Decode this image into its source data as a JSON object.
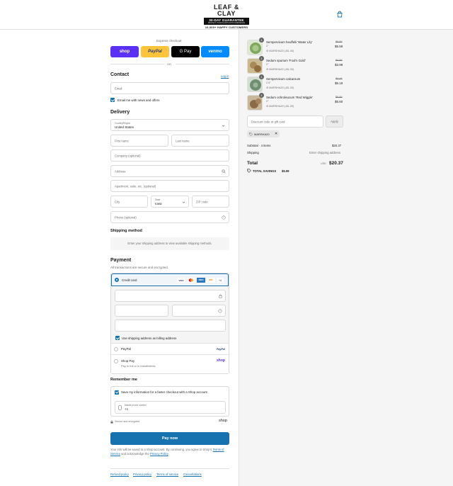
{
  "header": {
    "brand": "LEAF & CLAY",
    "guarantee": "30-DAY GUARANTEE",
    "guarantee_sub": "PROTECT YOUR PLANTS WITH CONFIDENCE",
    "customers": "10,000+ HAPPY CUSTOMERS",
    "cart_icon": "shopping-bag-icon"
  },
  "express": {
    "title": "Express checkout",
    "shop": "shop",
    "paypal": "PayPal",
    "gpay": "G Pay",
    "venmo": "venmo",
    "or": "OR"
  },
  "contact": {
    "heading": "Contact",
    "login": "Log in",
    "email_placeholder": "Email",
    "news_label": "Email me with news and offers"
  },
  "delivery": {
    "heading": "Delivery",
    "country_label": "Country/Region",
    "country_value": "United States",
    "first_name": "First name",
    "last_name": "Last name",
    "company": "Company (optional)",
    "address": "Address",
    "apartment": "Apartment, suite, etc. (optional)",
    "city": "City",
    "state_label": "State",
    "state_value": "Iowa",
    "zip": "ZIP code",
    "phone": "Phone (optional)"
  },
  "shipping": {
    "heading": "Shipping method",
    "notice": "Enter your shipping address to view available shipping methods."
  },
  "payment": {
    "heading": "Payment",
    "subtitle": "All transactions are secure and encrypted.",
    "credit_card": "Credit card",
    "card_brands": [
      "VISA",
      "MC",
      "AMEX",
      "DISC"
    ],
    "more_cards": "+4",
    "billing_label": "Use shipping address as billing address",
    "paypal": "PayPal",
    "paypal_logo": "PayPal",
    "shop_pay": "Shop Pay",
    "shop_pay_sub": "Pay in full or in installments",
    "shop_logo": "shop"
  },
  "remember": {
    "heading": "Remember me",
    "save_label": "Save my information for a faster checkout with a Shop account",
    "mobile_label": "Mobile phone number",
    "mobile_value": "+1",
    "secure": "Secure and encrypted",
    "shop_logo": "shop"
  },
  "pay_now": "Pay now",
  "legal": {
    "text1": "Your info will be saved to a Shop account. By continuing, you agree to Shop’s",
    "terms": "Terms of Service",
    "text2": "and acknowledge the",
    "privacy": "Privacy Policy",
    "text3": "."
  },
  "footer_links": [
    "Refund policy",
    "Privacy policy",
    "Terms of service",
    "Cancellations"
  ],
  "summary": {
    "items": [
      {
        "qty": "1",
        "name": "Sempervivum heuffelii 'Water Lily'",
        "size": "2\"",
        "discount": "MARSHA20 (-$1.40)",
        "old": "$6.99",
        "price": "$5.59",
        "color": "#7fa85a"
      },
      {
        "qty": "1",
        "name": "Sedum spurium 'Fool's Gold'",
        "size": "2\"",
        "discount": "MARSHA20 (-$1.00)",
        "old": "$4.99",
        "price": "$3.99",
        "color": "#a98a55"
      },
      {
        "qty": "1",
        "name": "Sempervivum calcareum",
        "size": "2.5\"",
        "discount": "MARSHA20 (-$1.30)",
        "old": "$6.49",
        "price": "$5.19",
        "color": "#6e8f70"
      },
      {
        "qty": "1",
        "name": "Sedum ochroleucum 'Red Wiggle'",
        "size": "2\"",
        "discount": "MARSHA20 (-$1.39)",
        "old": "$6.99",
        "price": "$5.60",
        "color": "#8a6a48"
      }
    ],
    "discount_placeholder": "Discount code or gift card",
    "apply": "Apply",
    "code_tag": "MARSHA20",
    "subtotal_label": "Subtotal · 4 items",
    "subtotal_value": "$20.37",
    "shipping_label": "Shipping",
    "shipping_value": "Enter shipping address",
    "total_label": "Total",
    "currency": "USD",
    "total_value": "$20.37",
    "savings_label": "TOTAL SAVINGS",
    "savings_value": "$5.09"
  }
}
